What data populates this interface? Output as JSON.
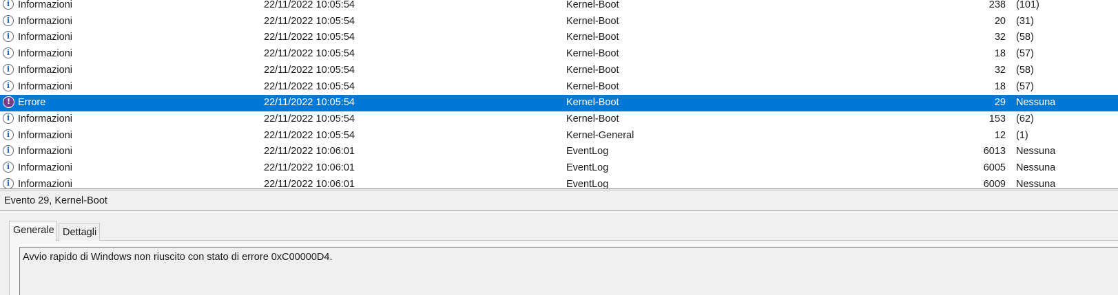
{
  "events": [
    {
      "level": "Informazioni",
      "icon": "info-icon",
      "datetime": "22/11/2022 10:05:54",
      "source": "Kernel-Boot",
      "id": "238",
      "category": "(101)",
      "selected": false
    },
    {
      "level": "Informazioni",
      "icon": "info-icon",
      "datetime": "22/11/2022 10:05:54",
      "source": "Kernel-Boot",
      "id": "20",
      "category": "(31)",
      "selected": false
    },
    {
      "level": "Informazioni",
      "icon": "info-icon",
      "datetime": "22/11/2022 10:05:54",
      "source": "Kernel-Boot",
      "id": "32",
      "category": "(58)",
      "selected": false
    },
    {
      "level": "Informazioni",
      "icon": "info-icon",
      "datetime": "22/11/2022 10:05:54",
      "source": "Kernel-Boot",
      "id": "18",
      "category": "(57)",
      "selected": false
    },
    {
      "level": "Informazioni",
      "icon": "info-icon",
      "datetime": "22/11/2022 10:05:54",
      "source": "Kernel-Boot",
      "id": "32",
      "category": "(58)",
      "selected": false
    },
    {
      "level": "Informazioni",
      "icon": "info-icon",
      "datetime": "22/11/2022 10:05:54",
      "source": "Kernel-Boot",
      "id": "18",
      "category": "(57)",
      "selected": false
    },
    {
      "level": "Errore",
      "icon": "error-icon",
      "datetime": "22/11/2022 10:05:54",
      "source": "Kernel-Boot",
      "id": "29",
      "category": "Nessuna",
      "selected": true
    },
    {
      "level": "Informazioni",
      "icon": "info-icon",
      "datetime": "22/11/2022 10:05:54",
      "source": "Kernel-Boot",
      "id": "153",
      "category": "(62)",
      "selected": false
    },
    {
      "level": "Informazioni",
      "icon": "info-icon",
      "datetime": "22/11/2022 10:05:54",
      "source": "Kernel-General",
      "id": "12",
      "category": "(1)",
      "selected": false
    },
    {
      "level": "Informazioni",
      "icon": "info-icon",
      "datetime": "22/11/2022 10:06:01",
      "source": "EventLog",
      "id": "6013",
      "category": "Nessuna",
      "selected": false
    },
    {
      "level": "Informazioni",
      "icon": "info-icon",
      "datetime": "22/11/2022 10:06:01",
      "source": "EventLog",
      "id": "6005",
      "category": "Nessuna",
      "selected": false
    },
    {
      "level": "Informazioni",
      "icon": "info-icon",
      "datetime": "22/11/2022 10:06:01",
      "source": "EventLog",
      "id": "6009",
      "category": "Nessuna",
      "selected": false
    }
  ],
  "detail": {
    "header": "Evento 29, Kernel-Boot",
    "tabs": [
      {
        "label": "Generale",
        "active": true
      },
      {
        "label": "Dettagli",
        "active": false
      }
    ],
    "message": "Avvio rapido di Windows non riuscito con stato di errore 0xC00000D4."
  },
  "colors": {
    "selection": "#0078d7",
    "panel_background": "#f0f0f0"
  }
}
